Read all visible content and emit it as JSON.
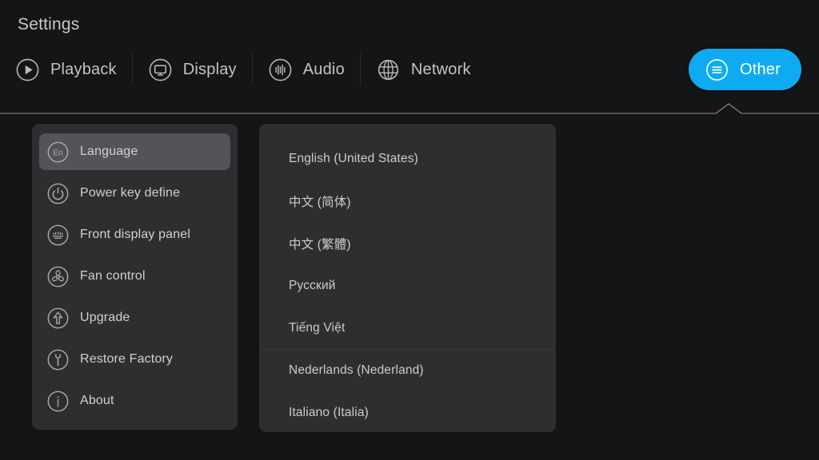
{
  "header": {
    "title": "Settings"
  },
  "tabs": [
    {
      "label": "Playback",
      "icon": "play-circle-icon",
      "active": false
    },
    {
      "label": "Display",
      "icon": "monitor-circle-icon",
      "active": false
    },
    {
      "label": "Audio",
      "icon": "equalizer-circle-icon",
      "active": false
    },
    {
      "label": "Network",
      "icon": "globe-icon",
      "active": false
    },
    {
      "label": "Other",
      "icon": "menu-circle-icon",
      "active": true
    }
  ],
  "sidebar": {
    "items": [
      {
        "label": "Language",
        "icon": "language-en-circle-icon",
        "selected": true
      },
      {
        "label": "Power key define",
        "icon": "power-circle-icon",
        "selected": false
      },
      {
        "label": "Front display panel",
        "icon": "front-panel-circle-icon",
        "selected": false
      },
      {
        "label": "Fan control",
        "icon": "fan-circle-icon",
        "selected": false
      },
      {
        "label": "Upgrade",
        "icon": "arrow-up-circle-icon",
        "selected": false
      },
      {
        "label": "Restore Factory",
        "icon": "wrench-circle-icon",
        "selected": false
      },
      {
        "label": "About",
        "icon": "info-circle-icon",
        "selected": false
      }
    ]
  },
  "language_panel": {
    "items": [
      {
        "label": "English (United States)",
        "divider_above": false
      },
      {
        "label": "中文 (简体)",
        "divider_above": false
      },
      {
        "label": "中文 (繁體)",
        "divider_above": false
      },
      {
        "label": "Русский",
        "divider_above": false
      },
      {
        "label": "Tiếng Việt",
        "divider_above": false
      },
      {
        "label": "Nederlands (Nederland)",
        "divider_above": true
      },
      {
        "label": "Italiano (Italia)",
        "divider_above": false
      }
    ]
  },
  "colors": {
    "background": "#141516",
    "panel": "#2c2e30",
    "selected_row": "#525457",
    "accent": "#0fabf2",
    "text": "#cacccd",
    "divider": "#3a3c3e"
  }
}
